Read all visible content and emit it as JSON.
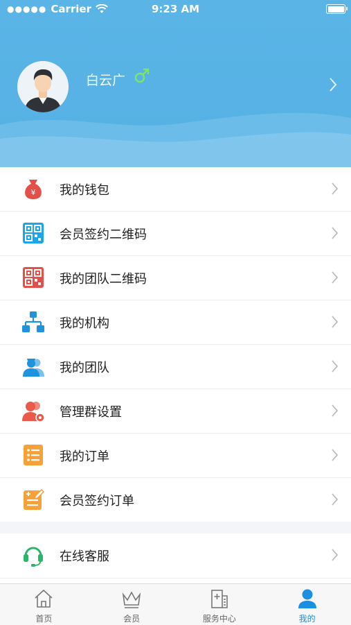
{
  "status_bar": {
    "carrier": "Carrier",
    "time": "9:23 AM"
  },
  "profile": {
    "name": "白云广",
    "gender_symbol": "male"
  },
  "menu": [
    {
      "label": "我的钱包",
      "icon": "wallet-icon"
    },
    {
      "label": "会员签约二维码",
      "icon": "qr-code-blue-icon"
    },
    {
      "label": "我的团队二维码",
      "icon": "qr-code-red-icon"
    },
    {
      "label": "我的机构",
      "icon": "org-chart-icon"
    },
    {
      "label": "我的团队",
      "icon": "team-icon"
    },
    {
      "label": "管理群设置",
      "icon": "group-settings-icon"
    },
    {
      "label": "我的订单",
      "icon": "order-list-icon"
    },
    {
      "label": "会员签约订单",
      "icon": "sign-order-icon"
    }
  ],
  "menu2": [
    {
      "label": "在线客服",
      "icon": "headset-icon"
    }
  ],
  "tabbar": [
    {
      "label": "首页",
      "icon": "home-icon"
    },
    {
      "label": "会员",
      "icon": "crown-icon"
    },
    {
      "label": "服务中心",
      "icon": "service-center-icon"
    },
    {
      "label": "我的",
      "icon": "user-icon",
      "active": true
    }
  ],
  "colors": {
    "header": "#56b1e4",
    "active_tab": "#1b8fe0",
    "wallet": "#e3504a",
    "qr_blue": "#1aa6ea",
    "qr_red": "#e3504a",
    "org": "#1f93de",
    "team": "#1f93de",
    "group": "#ea5a4a",
    "order": "#f6a13a",
    "sign_order": "#f6a13a",
    "headset": "#2db56a",
    "gender": "#7ee36a"
  }
}
